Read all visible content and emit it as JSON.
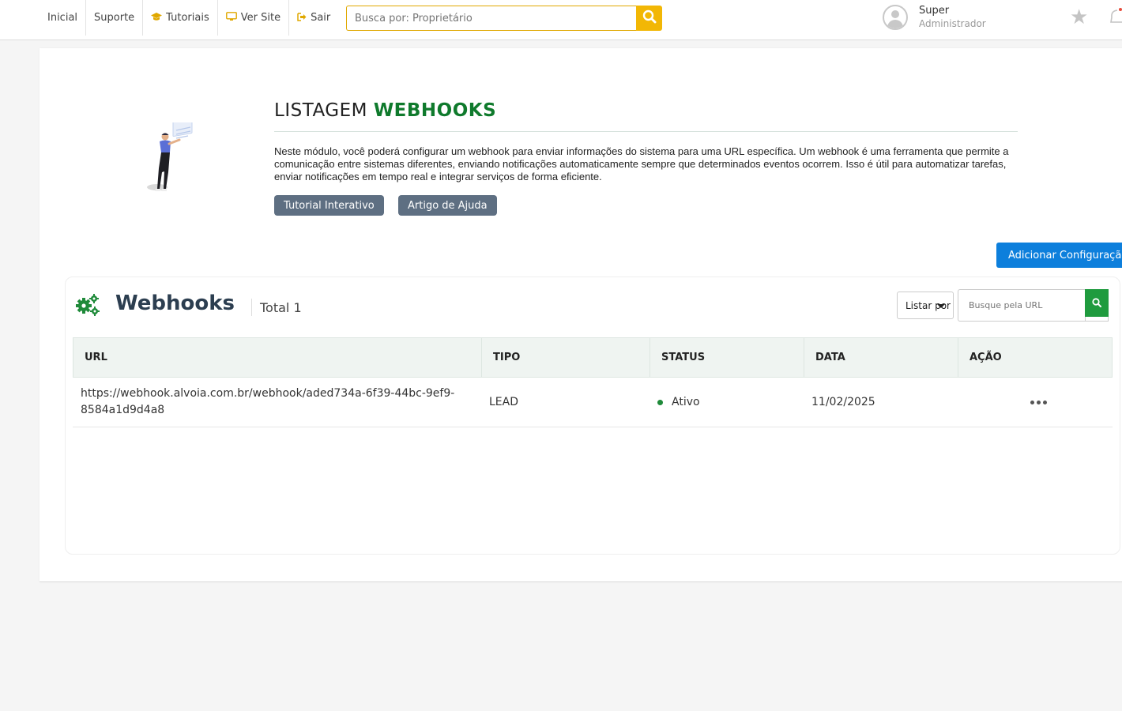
{
  "nav": {
    "items": [
      {
        "label": "Inicial",
        "icon": ""
      },
      {
        "label": "Suporte",
        "icon": ""
      },
      {
        "label": "Tutoriais",
        "icon": "graduation-cap-icon"
      },
      {
        "label": "Ver Site",
        "icon": "monitor-icon"
      },
      {
        "label": "Sair",
        "icon": "sign-out-icon"
      }
    ]
  },
  "search": {
    "placeholder": "Busca por: Proprietário"
  },
  "user": {
    "name": "Super",
    "role": "Administrador"
  },
  "hero": {
    "title_prefix": "LISTAGEM",
    "title_highlight": "WEBHOOKS",
    "description": "Neste módulo, você poderá configurar um webhook para enviar informações do sistema para uma URL específica. Um webhook é uma ferramenta que permite a comunicação entre sistemas diferentes, enviando notificações automaticamente sempre que determinados eventos ocorrem. Isso é útil para automatizar tarefas, enviar notificações em tempo real e integrar serviços de forma eficiente.",
    "btn_tutorial": "Tutorial Interativo",
    "btn_article": "Artigo de Ajuda"
  },
  "add_button": "Adicionar Configuração",
  "webhooks": {
    "title": "Webhooks",
    "total": "Total 1",
    "sort_label": "Listar por",
    "url_search_placeholder": "Busque pela URL",
    "columns": [
      "URL",
      "TIPO",
      "STATUS",
      "DATA",
      "AÇÃO"
    ],
    "rows": [
      {
        "url": "https://webhook.alvoia.com.br/webhook/aded734a-6f39-44bc-9ef9-8584a1d9d4a8",
        "tipo": "LEAD",
        "status": "Ativo",
        "data": "11/02/2025"
      }
    ]
  },
  "colors": {
    "accent_yellow": "#f2b705",
    "brand_green": "#0f7a2c",
    "primary_blue": "#0d7fdc",
    "status_active": "#1f8a3a"
  }
}
